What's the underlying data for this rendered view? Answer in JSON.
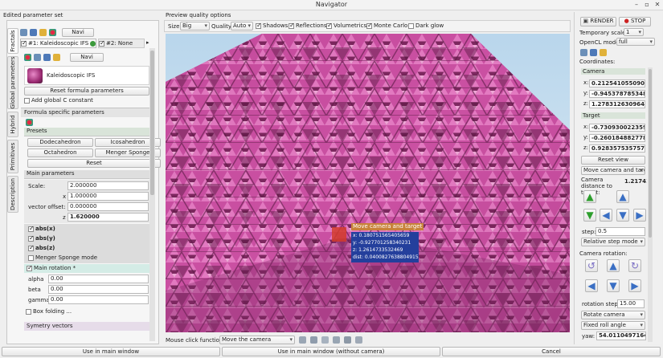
{
  "window": {
    "title": "Navigator"
  },
  "left": {
    "heading": "Edited parameter set",
    "tabs": [
      "Fractals",
      "Global parameters",
      "Hybrid",
      "Primitives",
      "Description"
    ],
    "navi_label": "Navi",
    "formula_tabs": [
      "#1: Kaleidoscopic IFS",
      "#2: None"
    ],
    "navi_label_2": "Navi",
    "formula_name": "Kaleidoscopic IFS",
    "reset_formula": "Reset formula parameters",
    "add_global_c": "Add global C constant",
    "formula_specific": "Formula specific parameters",
    "presets_heading": "Presets",
    "presets": [
      "Dodecahedron",
      "Icosahedron",
      "Octahedron",
      "Menger Sponge"
    ],
    "reset_label": "Reset",
    "main_params_heading": "Main parameters",
    "scale_label": "Scale:",
    "scale_value": "2.000000",
    "x_label": "x",
    "x_value": "1.000000",
    "vector_offset_label": "vector offset: y",
    "y_value": "0.000000",
    "z_label": "z",
    "z_value": "1.620000",
    "abs_x": "abs(x)",
    "abs_y": "abs(y)",
    "abs_z": "abs(z)",
    "menger_mode": "Menger Sponge mode",
    "main_rotation": "Main rotation *",
    "alpha_label": "alpha",
    "alpha_value": "0.00",
    "beta_label": "beta",
    "beta_value": "0.00",
    "gamma_label": "gamma",
    "gamma_value": "0.00",
    "box_folding": "Box folding ...",
    "symmetry_vectors": "Symetry vectors"
  },
  "preview": {
    "heading": "Preview quality options",
    "size_label": "Size",
    "size_value": "Big",
    "quality_label": "Quality",
    "quality_value": "Auto",
    "options": [
      {
        "label": "Shadows",
        "checked": true
      },
      {
        "label": "Reflections",
        "checked": true
      },
      {
        "label": "Volumetrics",
        "checked": true
      },
      {
        "label": "Monte Carlo",
        "checked": true
      },
      {
        "label": "Dark glow",
        "checked": false
      }
    ],
    "overlay_label": "Move camera and target",
    "overlay_lines": [
      "x: 0.180751565405659",
      "y: -0.927701258340231",
      "z: 1.2614733532469",
      "dist: 0.0400827638804915"
    ],
    "mouse_click_label": "Mouse click function:",
    "mouse_click_value": "Move the camera"
  },
  "right": {
    "render_label": "RENDER",
    "stop_label": "STOP",
    "temp_scale_label": "Temporary scale:",
    "temp_scale_value": "1",
    "opencl_label": "OpenCL mode:",
    "opencl_value": "full",
    "coordinates_heading": "Coordinates:",
    "camera_heading": "Camera",
    "camera": {
      "x": "0.2125410550902097",
      "y": "-0.9453787853483",
      "z": "1.2783126309648"
    },
    "target_heading": "Target",
    "target": {
      "x": "-0.7309300223598",
      "y": "-0.2601848827788",
      "z": "0.9283575357576"
    },
    "reset_view": "Reset view",
    "move_mode": "Move camera and targ",
    "camera_distance_label": "Camera distance to target:",
    "camera_distance_value": "1.21741",
    "step_label": "step:",
    "step_value": "0.5",
    "relative_step_mode": "Relative step mode",
    "camera_rotation_label": "Camera rotation:",
    "rotation_step_label": "rotation step:",
    "rotation_step_value": "15.00",
    "rotate_camera": "Rotate camera",
    "fixed_roll": "Fixed roll angle",
    "yaw_label": "yaw:",
    "yaw_value": "54.01104971644"
  },
  "bottom": {
    "use_main": "Use in main window",
    "use_main_no_camera": "Use in main window (without camera)",
    "cancel": "Cancel"
  }
}
